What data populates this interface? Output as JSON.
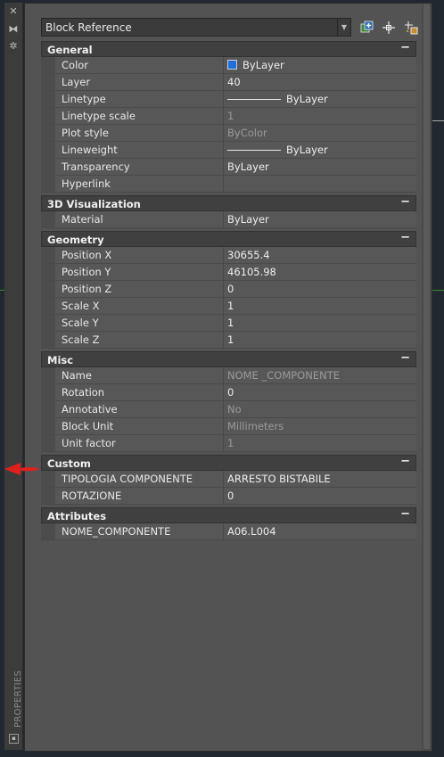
{
  "window": {
    "side_label": "PROPERTIES"
  },
  "selector": {
    "value": "Block Reference"
  },
  "sections": [
    {
      "title": "General",
      "rows": [
        {
          "key": "Color",
          "value": "ByLayer",
          "swatch": "#1f6fe0"
        },
        {
          "key": "Layer",
          "value": "40"
        },
        {
          "key": "Linetype",
          "value": "ByLayer",
          "line": true
        },
        {
          "key": "Linetype scale",
          "value": "1",
          "dim": true
        },
        {
          "key": "Plot style",
          "value": "ByColor",
          "dim": true
        },
        {
          "key": "Lineweight",
          "value": "ByLayer",
          "line": true
        },
        {
          "key": "Transparency",
          "value": "ByLayer"
        },
        {
          "key": "Hyperlink",
          "value": ""
        }
      ]
    },
    {
      "title": "3D Visualization",
      "rows": [
        {
          "key": "Material",
          "value": "ByLayer"
        }
      ]
    },
    {
      "title": "Geometry",
      "rows": [
        {
          "key": "Position X",
          "value": "30655.4"
        },
        {
          "key": "Position Y",
          "value": "46105.98"
        },
        {
          "key": "Position Z",
          "value": "0"
        },
        {
          "key": "Scale X",
          "value": "1"
        },
        {
          "key": "Scale Y",
          "value": "1"
        },
        {
          "key": "Scale Z",
          "value": "1"
        }
      ]
    },
    {
      "title": "Misc",
      "rows": [
        {
          "key": "Name",
          "value": "NOME _COMPONENTE",
          "dim": true
        },
        {
          "key": "Rotation",
          "value": "0"
        },
        {
          "key": "Annotative",
          "value": "No",
          "dim": true
        },
        {
          "key": "Block Unit",
          "value": "Millimeters",
          "dim": true
        },
        {
          "key": "Unit factor",
          "value": "1",
          "dim": true
        }
      ]
    },
    {
      "title": "Custom",
      "rows": [
        {
          "key": "TIPOLOGIA COMPONENTE",
          "value": "ARRESTO BISTABILE"
        },
        {
          "key": "ROTAZIONE",
          "value": "0"
        }
      ]
    },
    {
      "title": "Attributes",
      "rows": [
        {
          "key": "NOME_COMPONENTE",
          "value": "A06.L004"
        }
      ]
    }
  ],
  "collapse_symbol": "−",
  "colors": {
    "accent_arrow": "#e0201c",
    "swatch_blue": "#1f6fe0"
  }
}
